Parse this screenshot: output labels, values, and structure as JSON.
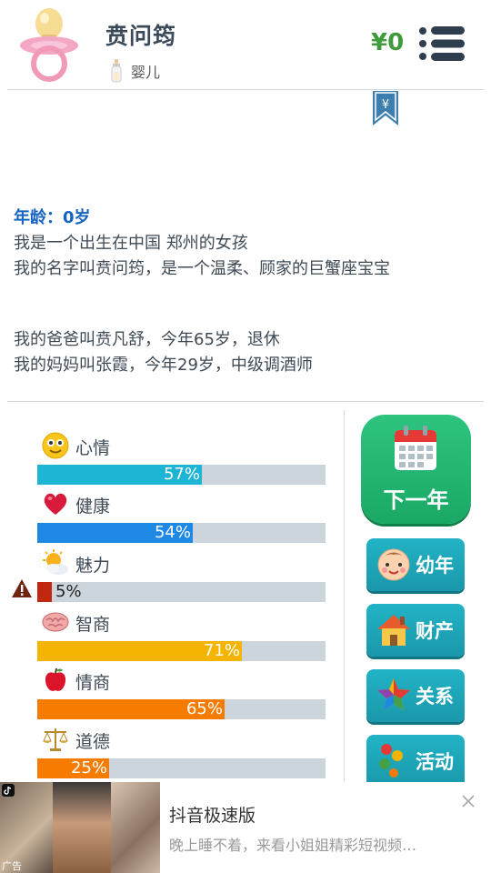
{
  "header": {
    "name": "贲问筠",
    "stage": "婴儿",
    "money": "¥0"
  },
  "story": {
    "age_line": "年龄：0岁",
    "lines_1": [
      "我是一个出生在中国 郑州的女孩",
      "我的名字叫贲问筠，是一个温柔、顾家的巨蟹座宝宝"
    ],
    "lines_2": [
      "我的爸爸叫贲凡舒，今年65岁，退休",
      "我的妈妈叫张霞，今年29岁，中级调酒师"
    ]
  },
  "stats": [
    {
      "label": "心情",
      "icon": "smiley-icon",
      "value": 57,
      "text": "57%",
      "color": "#1eb4d4"
    },
    {
      "label": "健康",
      "icon": "heart-icon",
      "value": 54,
      "text": "54%",
      "color": "#1e88e5"
    },
    {
      "label": "魅力",
      "icon": "sun-cloud-icon",
      "value": 5,
      "text": "5%",
      "color": "#c0280f"
    },
    {
      "label": "智商",
      "icon": "brain-icon",
      "value": 71,
      "text": "71%",
      "color": "#f5b400"
    },
    {
      "label": "情商",
      "icon": "apple-icon",
      "value": 65,
      "text": "65%",
      "color": "#f57c00"
    },
    {
      "label": "道德",
      "icon": "scales-icon",
      "value": 25,
      "text": "25%",
      "color": "#f57c00"
    }
  ],
  "actions": {
    "next_year": "下一年",
    "buttons": [
      {
        "label": "幼年",
        "icon": "baby-face-icon"
      },
      {
        "label": "财产",
        "icon": "house-icon"
      },
      {
        "label": "关系",
        "icon": "star-icon"
      },
      {
        "label": "活动",
        "icon": "dots-icon"
      }
    ]
  },
  "ad": {
    "title": "抖音极速版",
    "description": "晚上睡不着，来看小姐姐精彩短视频…",
    "tag": "广告"
  }
}
